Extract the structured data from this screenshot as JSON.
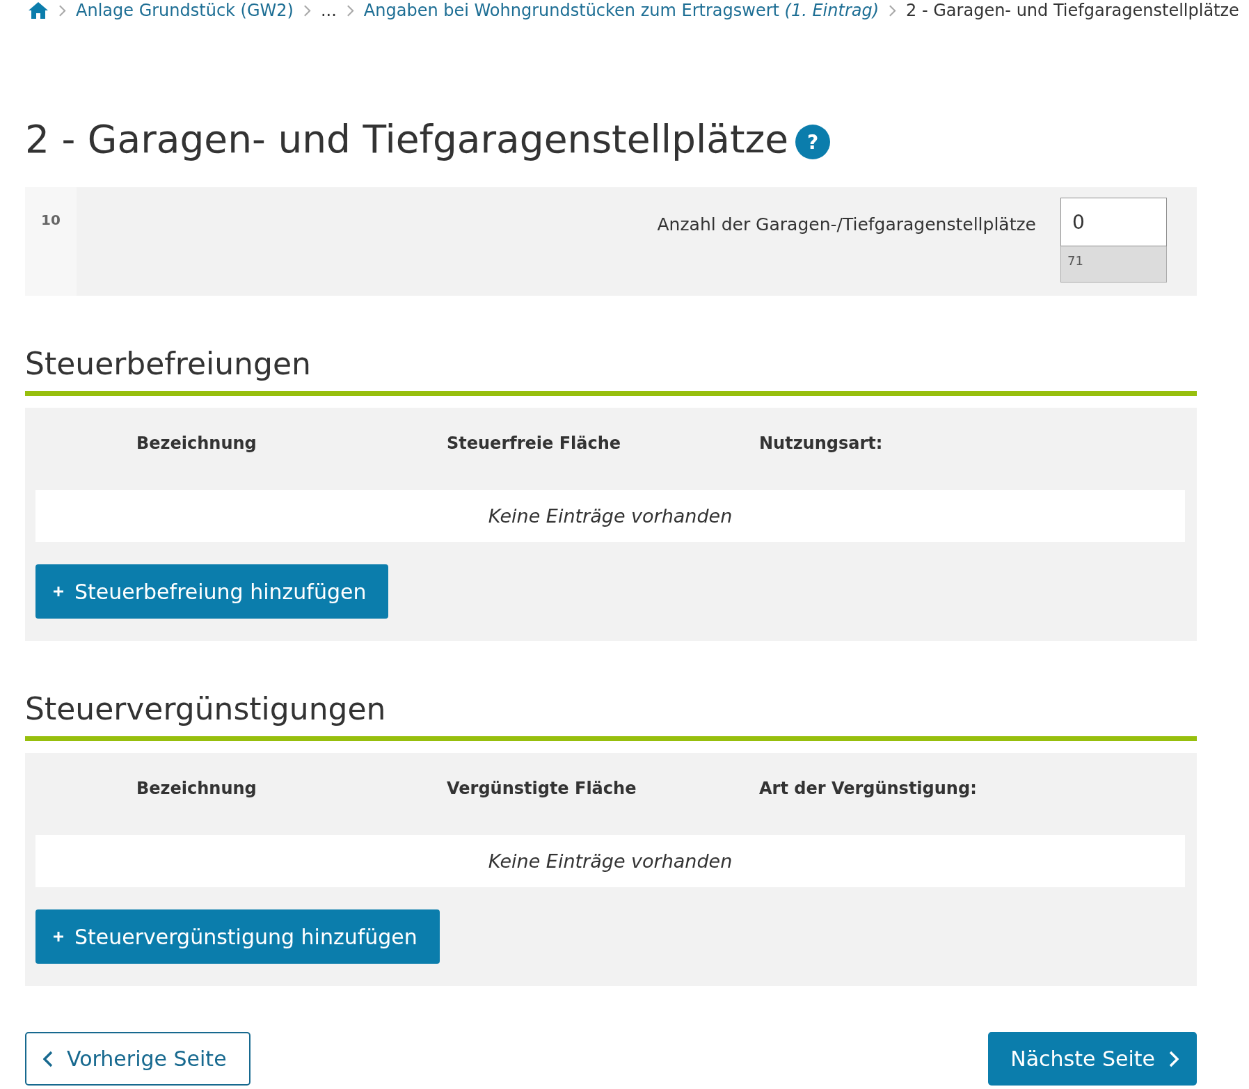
{
  "breadcrumb": {
    "items": [
      {
        "kind": "home"
      },
      {
        "kind": "link",
        "label": "Anlage Grundstück (GW2)"
      },
      {
        "kind": "ellipsis",
        "label": "..."
      },
      {
        "kind": "link",
        "label": "Angaben bei Wohngrundstücken zum Ertragswert *(1. Eintrag)*"
      },
      {
        "kind": "current",
        "label": "2 - Garagen- und Tiefgaragenstellplätze"
      }
    ]
  },
  "page_title": {
    "text": "2 - Garagen- und Tiefgaragenstellplätze",
    "help": "?"
  },
  "form_rows": [
    {
      "line": "10",
      "label": "Anzahl der Garagen-/Tiefgaragenstellplätze",
      "value": "0",
      "code": "71"
    }
  ],
  "sections": [
    {
      "title": "Steuerbefreiungen",
      "columns": [
        "Bezeichnung",
        "Steuerfreie Fläche",
        "Nutzungsart:"
      ],
      "empty_text": "Keine Einträge vorhanden",
      "add_button": "Steuerbefreiung hinzufügen"
    },
    {
      "title": "Steuervergünstigungen",
      "columns": [
        "Bezeichnung",
        "Vergünstigte Fläche",
        "Art der Vergünstigung:"
      ],
      "empty_text": "Keine Einträge vorhanden",
      "add_button": "Steuervergünstigung hinzufügen"
    }
  ],
  "navigation": {
    "previous": "Vorherige Seite",
    "next": "Nächste Seite"
  }
}
